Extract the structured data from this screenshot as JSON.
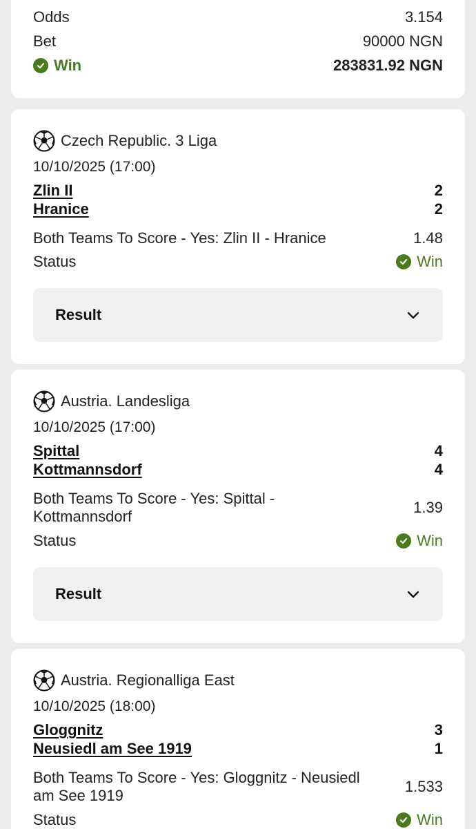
{
  "summary": {
    "odds_label": "Odds",
    "odds_value": "3.154",
    "bet_label": "Bet",
    "bet_value": "90000 NGN",
    "win_label": "Win",
    "win_value": "283831.92 NGN"
  },
  "matches": [
    {
      "league": "Czech Republic. 3 Liga",
      "datetime": "10/10/2025 (17:00)",
      "team1": "Zlin II",
      "score1": "2",
      "team2": "Hranice",
      "score2": "2",
      "bet": "Both Teams To Score - Yes: Zlin II - Hranice",
      "odds": "1.48",
      "status_label": "Status",
      "status": "Win",
      "result_label": "Result"
    },
    {
      "league": "Austria. Landesliga",
      "datetime": "10/10/2025 (17:00)",
      "team1": "Spittal",
      "score1": "4",
      "team2": "Kottmannsdorf",
      "score2": "4",
      "bet": "Both Teams To Score - Yes: Spittal - Kottmannsdorf",
      "odds": "1.39",
      "status_label": "Status",
      "status": "Win",
      "result_label": "Result"
    },
    {
      "league": "Austria. Regionalliga East",
      "datetime": "10/10/2025 (18:00)",
      "team1": "Gloggnitz",
      "score1": "3",
      "team2": "Neusiedl am See 1919",
      "score2": "1",
      "bet": "Both Teams To Score - Yes: Gloggnitz - Neusiedl am See 1919",
      "odds": "1.533",
      "status_label": "Status",
      "status": "Win"
    }
  ],
  "colors": {
    "win_green": "#4a7a1e",
    "page_bg": "#ececec",
    "card_bg": "#ffffff",
    "button_bg": "#f0f0f0"
  },
  "icons": {
    "sport": "soccer-ball-icon",
    "status": "check-circle-icon",
    "expand": "chevron-down-icon"
  }
}
